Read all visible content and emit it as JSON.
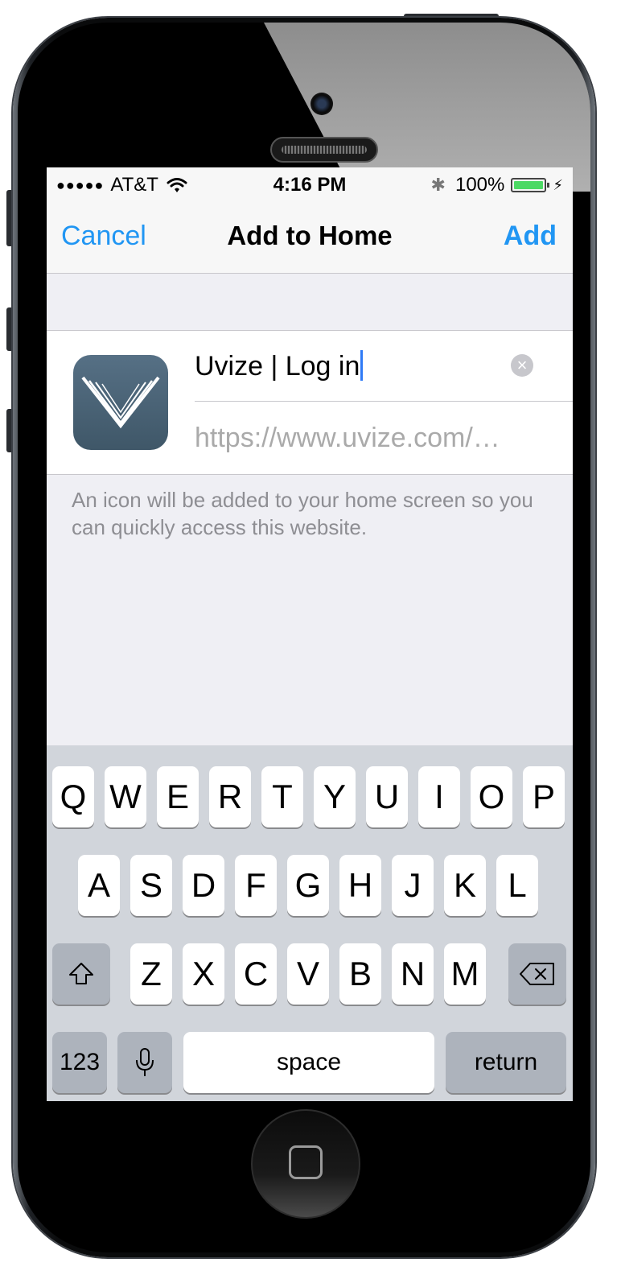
{
  "status_bar": {
    "signal": "●●●●●",
    "carrier": "AT&T",
    "wifi_icon": "wifi-icon",
    "time": "4:16 PM",
    "bluetooth_icon": "bluetooth-icon",
    "battery_percent": "100%",
    "battery_level": 1.0,
    "battery_color": "#4cd964"
  },
  "nav": {
    "cancel_label": "Cancel",
    "title": "Add to Home",
    "add_label": "Add",
    "accent_color": "#2196f3"
  },
  "form": {
    "app_icon": "uvize-app-icon",
    "title_value": "Uvize | Log in",
    "url_value": "https://www.uvize.com/…",
    "clear_icon": "clear-icon"
  },
  "helper_text": "An icon will be added to your home screen so you can quickly access this website.",
  "keyboard": {
    "row1": [
      "Q",
      "W",
      "E",
      "R",
      "T",
      "Y",
      "U",
      "I",
      "O",
      "P"
    ],
    "row2": [
      "A",
      "S",
      "D",
      "F",
      "G",
      "H",
      "J",
      "K",
      "L"
    ],
    "row3": [
      "Z",
      "X",
      "C",
      "V",
      "B",
      "N",
      "M"
    ],
    "shift_icon": "shift-icon",
    "delete_icon": "backspace-icon",
    "numbers_label": "123",
    "mic_icon": "microphone-icon",
    "space_label": "space",
    "return_label": "return"
  },
  "device": {
    "home_button": "home-button"
  }
}
